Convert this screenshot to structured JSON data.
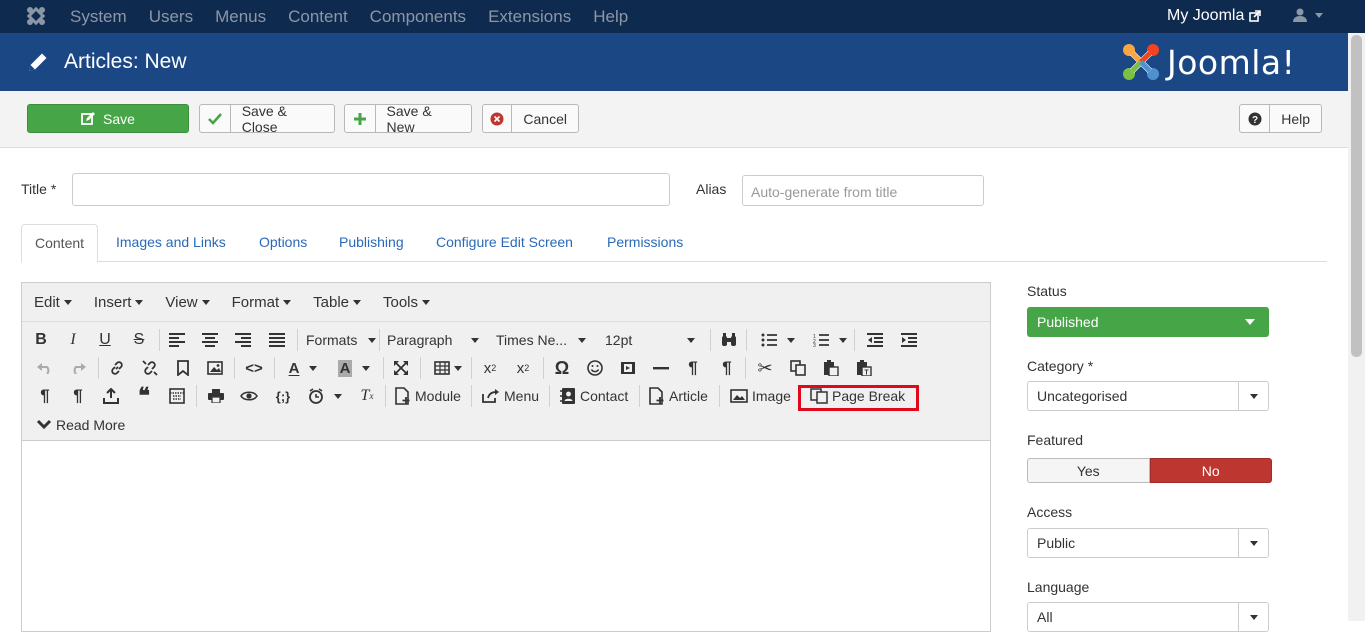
{
  "topnav": {
    "menu": [
      "System",
      "Users",
      "Menus",
      "Content",
      "Components",
      "Extensions",
      "Help"
    ],
    "site_link": "My Joomla"
  },
  "header": {
    "title": "Articles: New",
    "brand": "Joomla!"
  },
  "toolbar": {
    "save": "Save",
    "save_close": "Save & Close",
    "save_new": "Save & New",
    "cancel": "Cancel",
    "help": "Help"
  },
  "form": {
    "title_label": "Title *",
    "title_value": "",
    "alias_label": "Alias",
    "alias_placeholder": "Auto-generate from title"
  },
  "tabs": [
    "Content",
    "Images and Links",
    "Options",
    "Publishing",
    "Configure Edit Screen",
    "Permissions"
  ],
  "editor": {
    "menus": [
      "Edit",
      "Insert",
      "View",
      "Format",
      "Table",
      "Tools"
    ],
    "formats": "Formats",
    "block": "Paragraph",
    "font": "Times Ne...",
    "size": "12pt",
    "buttons": {
      "module": "Module",
      "menu": "Menu",
      "contact": "Contact",
      "article": "Article",
      "image": "Image",
      "page_break": "Page Break",
      "read_more": "Read More"
    },
    "highlight_color": "#e1081b"
  },
  "sidebar": {
    "status_label": "Status",
    "status_value": "Published",
    "category_label": "Category *",
    "category_value": "Uncategorised",
    "featured_label": "Featured",
    "yes": "Yes",
    "no": "No",
    "access_label": "Access",
    "access_value": "Public",
    "language_label": "Language",
    "language_value": "All"
  },
  "colors": {
    "topnav": "#0f2a4f",
    "header": "#1b4785",
    "success": "#46a546",
    "danger": "#bd362f",
    "link": "#2a69b8"
  }
}
